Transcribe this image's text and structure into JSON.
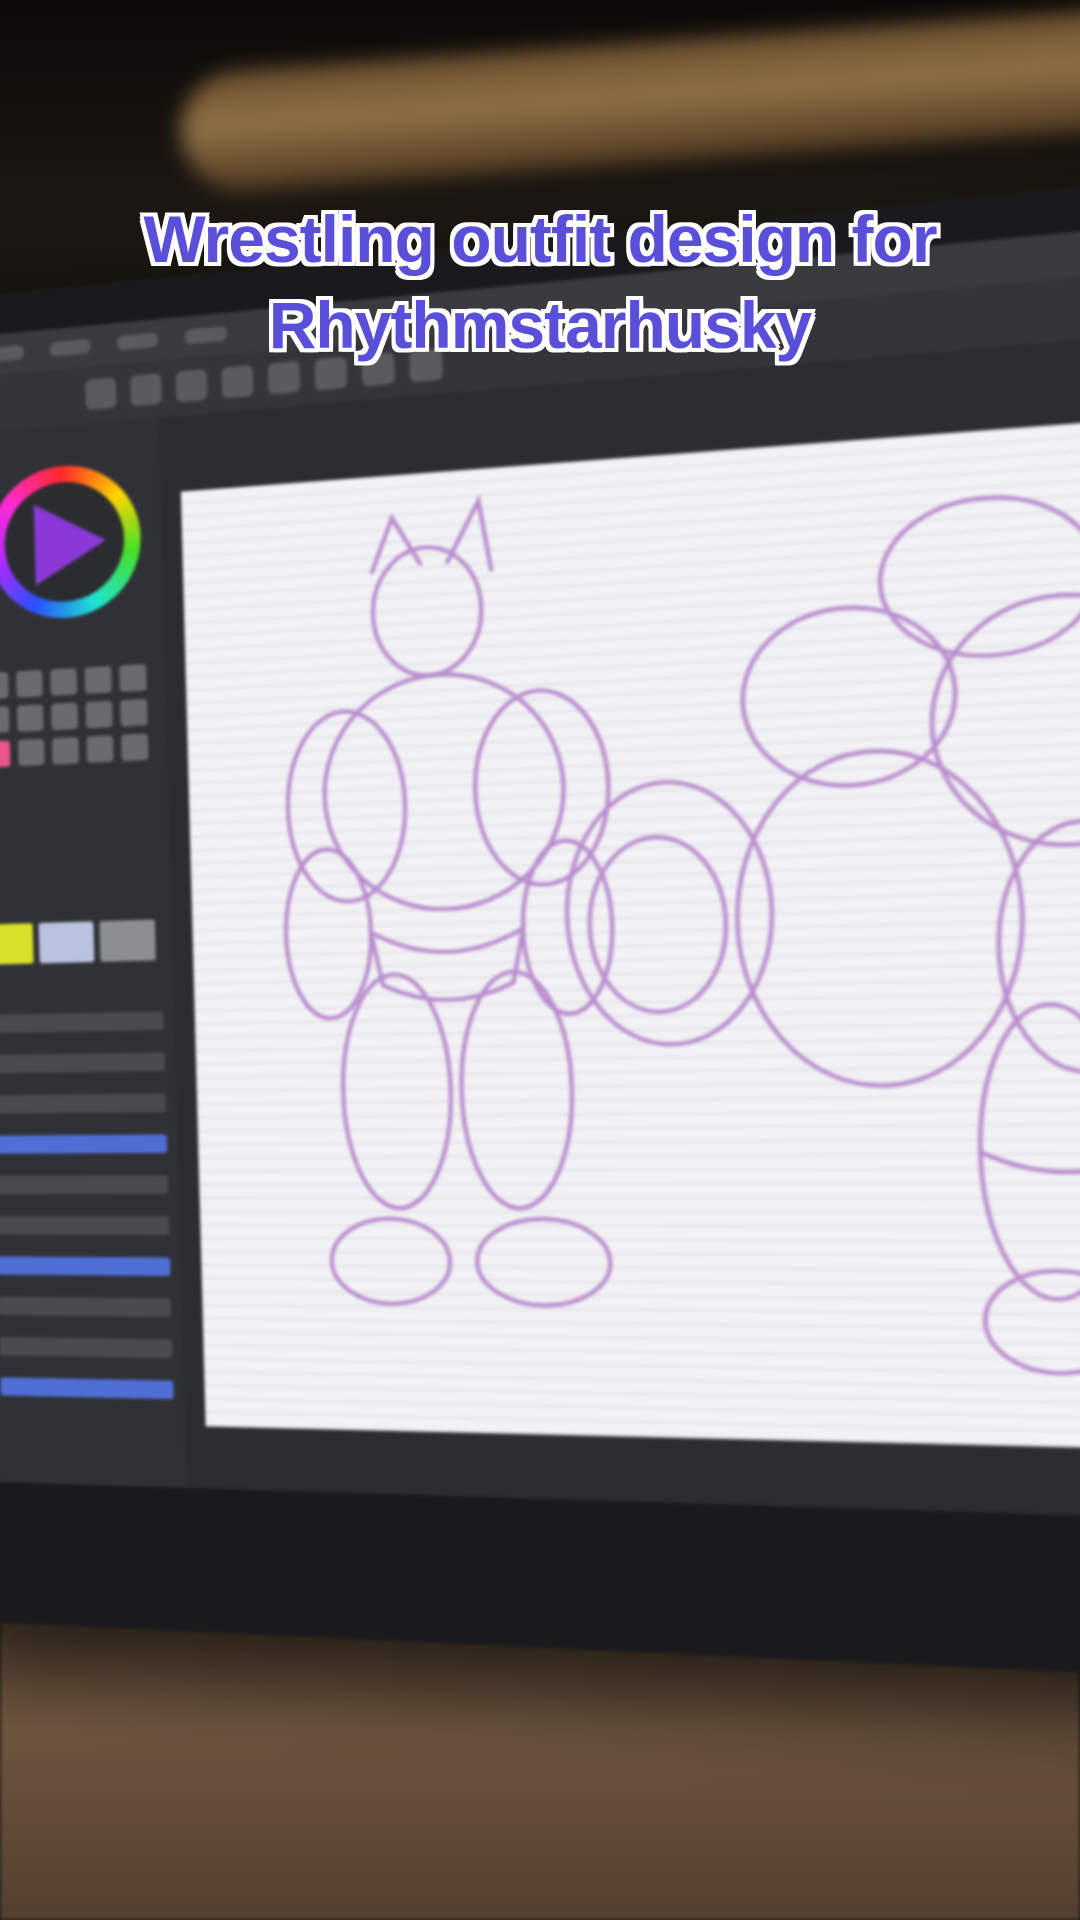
{
  "caption": {
    "line1": "Wrestling outfit design for",
    "line2": "Rhythmstarhusky",
    "color": "#5a4fd8"
  },
  "colors": {
    "sketch_stroke": "#b07ac8",
    "canvas": "#f2f2f4",
    "accent_blue": "#3d6fcf"
  }
}
